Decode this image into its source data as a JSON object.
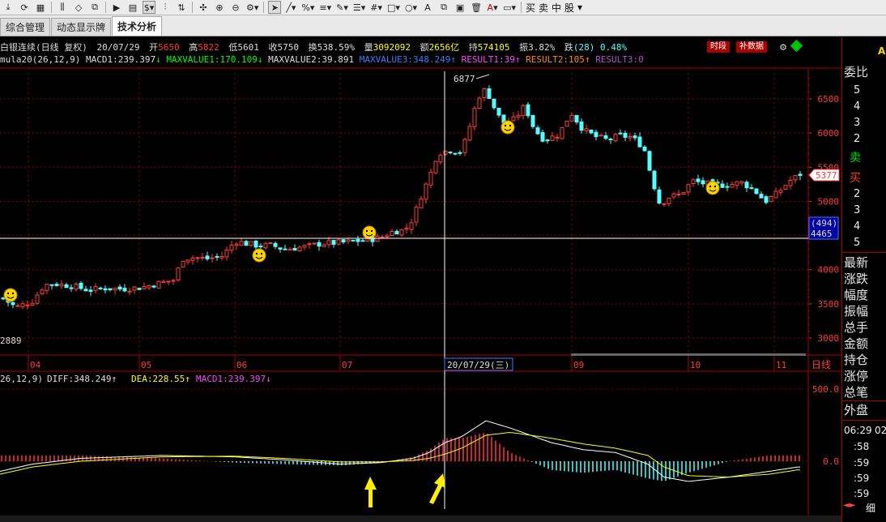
{
  "toolbar": {
    "icons": [
      "download-icon",
      "refresh-icon",
      "layout-icon",
      "candlestick-icon",
      "diamond-icon",
      "compare-icon",
      "replay-icon",
      "document-icon",
      "dollar-icon",
      "indicator-icon",
      "sort-icon",
      "crosshair-icon",
      "zoom-in-icon",
      "zoom-out-icon",
      "settings-icon",
      "cursor-icon",
      "line-draw-icon",
      "percent-icon",
      "fibonacci-icon",
      "pen-icon",
      "list-icon",
      "grid-icon",
      "rect-icon",
      "circle-icon",
      "text-icon",
      "copy-icon",
      "paste-icon",
      "delete-icon",
      "color-icon",
      "save-icon"
    ],
    "buy_label": "买",
    "sell_label": "卖",
    "neutral_label": "中",
    "stock_label": "股"
  },
  "tabs": [
    {
      "label": "综合管理"
    },
    {
      "label": "动态显示牌"
    },
    {
      "label": "技术分析"
    }
  ],
  "info": {
    "name": "白银连续(日线 复权)",
    "date": "20/07/29",
    "open_label": "开",
    "open": "5650",
    "high_label": "高",
    "high": "5822",
    "low_label": "低",
    "low": "5601",
    "close_label": "收",
    "close": "5750",
    "turnover_label": "换",
    "turnover": "538.59%",
    "volume_label": "量",
    "volume": "3092092",
    "amount_label": "额",
    "amount": "2656亿",
    "position_label": "持",
    "position": "574105",
    "amplitude_label": "振",
    "amplitude": "3.82%",
    "change_label": "跌",
    "change": "(28)",
    "change_pct": "0.48%",
    "btn_timeframe": "时段",
    "btn_data": "补数据"
  },
  "formula": {
    "prefix": "mula20(26,12,9)",
    "macd1": "MACD1:239.397",
    "maxvalue1": "MAXVALUE1:170.109",
    "maxvalue2": "MAXVALUE2:39.891",
    "maxvalue3": "MAXVALUE3:348.249",
    "result1": "RESULT1:39",
    "result2": "RESULT2:105",
    "result3": "RESULT3:0"
  },
  "main_chart": {
    "y_ticks": [
      "6500",
      "6000",
      "5500",
      "5000",
      "4500",
      "4000",
      "3500",
      "3000"
    ],
    "y_min": 2889,
    "y_max": 6877,
    "peak_label": "6877",
    "low_label": "2889",
    "last_price": "5377",
    "cursor_price": "4465",
    "cursor_diff": "(494)",
    "x_months": [
      "04",
      "05",
      "06",
      "07",
      "09",
      "10",
      "11"
    ],
    "cursor_date_label": "20/07/29(三)",
    "period_label": "日线"
  },
  "macd": {
    "header_prefix": "26,12,9)",
    "diff": "DIFF:348.249",
    "dea": "DEA:228.55",
    "macd1": "MACD1:239.397",
    "y_ticks": [
      "500.0",
      "0.0"
    ]
  },
  "right_panel": {
    "corner": "AG",
    "title": "委比",
    "ask_levels": [
      "5",
      "4",
      "3",
      "2"
    ],
    "sell_label": "卖",
    "buy_label": "买",
    "bid_levels": [
      "2",
      "3",
      "4",
      "5"
    ],
    "fields": [
      "最新",
      "涨跌",
      "幅度",
      "振幅",
      "总手",
      "金额",
      "持仓",
      "涨停",
      "总笔"
    ],
    "outer_label": "外盘",
    "times": [
      "06:29",
      "02",
      ":58",
      ":59",
      ":59",
      ":59"
    ],
    "fine_label": "细"
  },
  "colors": {
    "up": "#ff3b3b",
    "down": "#54ffff",
    "ma_white": "#ffffff",
    "ma_yellow": "#ffff00",
    "grid": "#8b0000",
    "green_text": "#00ff00",
    "blue_text": "#3a7bff",
    "magenta_text": "#ff44ff",
    "orange_text": "#ff8a00",
    "purple_text": "#b050c8"
  }
}
